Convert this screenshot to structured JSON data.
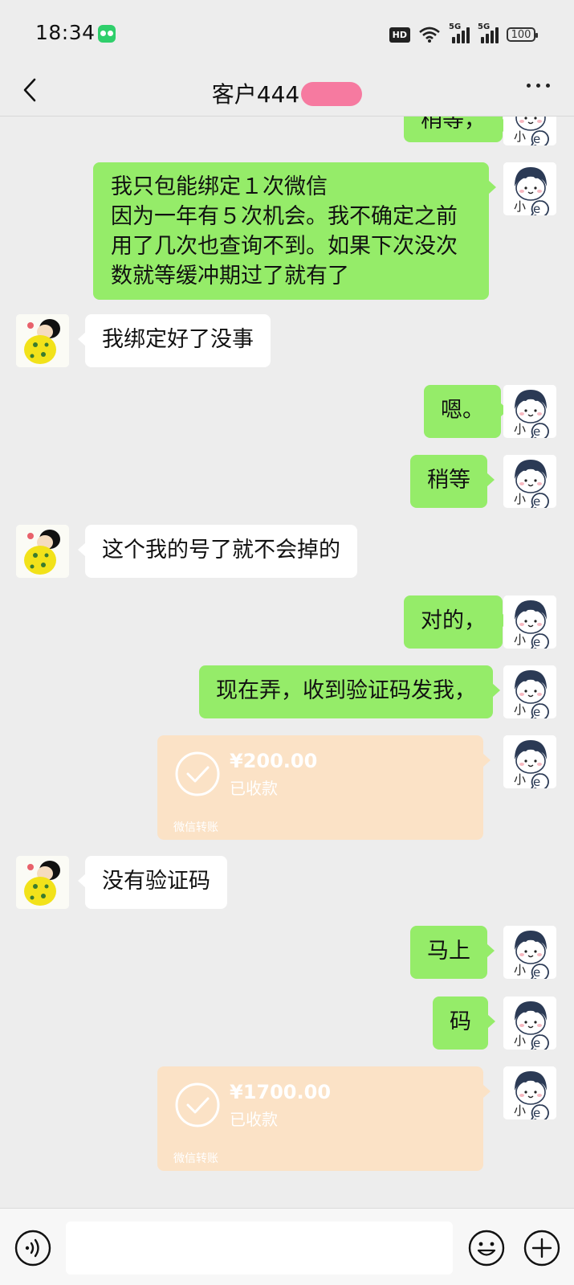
{
  "status_bar": {
    "time": "18:34",
    "hd_label": "HD",
    "signal1_tag": "5G",
    "signal2_tag": "5G",
    "battery_level": "100"
  },
  "header": {
    "title": "客户444",
    "back_icon": "chevron-left-icon",
    "more_icon": "more-dots-icon"
  },
  "messages": [
    {
      "side": "me",
      "text": "稍等，"
    },
    {
      "side": "me",
      "lines": [
        "我只包能绑定１次微信",
        "因为一年有５次机会。我不确定之前",
        "用了几次也查询不到。如果下次没次",
        "数就等缓冲期过了就有了"
      ]
    },
    {
      "side": "other",
      "text": "我绑定好了没事"
    },
    {
      "side": "me",
      "text": "嗯。"
    },
    {
      "side": "me",
      "text": "稍等"
    },
    {
      "side": "other",
      "text": "这个我的号了就不会掉的"
    },
    {
      "side": "me",
      "text": "对的，"
    },
    {
      "side": "me",
      "text": "现在弄，收到验证码发我，"
    },
    {
      "side": "me",
      "type": "transfer",
      "amount": "¥200.00",
      "status": "已收款",
      "source": "微信转账"
    },
    {
      "side": "other",
      "text": "没有验证码"
    },
    {
      "side": "me",
      "text": "马上"
    },
    {
      "side": "me",
      "text": "码"
    },
    {
      "side": "me",
      "type": "transfer",
      "amount": "¥1700.00",
      "status": "已收款",
      "source": "微信转账"
    }
  ],
  "input_bar": {
    "placeholder": "",
    "voice_icon": "voice-icon",
    "emoji_icon": "emoji-icon",
    "plus_icon": "plus-icon"
  },
  "colors": {
    "background": "#ededed",
    "my_bubble": "#95ec69",
    "other_bubble": "#ffffff",
    "transfer_card": "#fbe2c6",
    "title_mask": "#f67aa0"
  }
}
